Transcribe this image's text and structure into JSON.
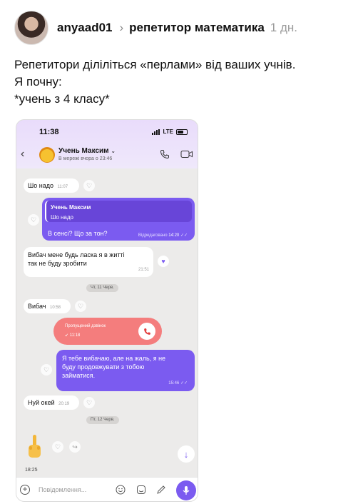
{
  "post": {
    "username": "anyaad01",
    "chevron": "›",
    "topic": "репетитор математика",
    "time": "1 дн.",
    "lines": [
      "Репетитори діліліться «перлами» від ваших учнів.",
      "Я почну:",
      "*учень з 4 класу*"
    ]
  },
  "phone": {
    "status_time": "11:38",
    "network": "LTE",
    "contact_name": "Учень Максим",
    "contact_dropdown": "⌄",
    "contact_status": "В мережі вчора о 23:46",
    "back_icon": "‹",
    "messages": [
      {
        "text": "Шо надо",
        "time": "11:07"
      },
      {
        "reply_name": "Учень Максим",
        "reply_text": "Шо надо",
        "text": "В сенсі? Що за тон?",
        "edited": "Відредаговано",
        "time": "14:20"
      },
      {
        "text_l1": "Вибач мене будь ласка я в житті",
        "text_l2": "так не буду зробити",
        "time": "21:51"
      },
      {
        "text": "Вибач",
        "time": "10:58"
      },
      {
        "text_l1": "Я тебе вибачаю, але на жаль, я не",
        "text_l2": "буду продовжувати з тобою",
        "text_l3": "займатися.",
        "time": "15:46"
      },
      {
        "text": "Нуй окей",
        "time": "20:19"
      }
    ],
    "date_chips": [
      "Чт, 11 Черв.",
      "Пт, 12 Черв."
    ],
    "missed_call": {
      "title": "Пропущений дзвінок",
      "time": "11:18"
    },
    "hand_time": "18:25",
    "composer_placeholder": "Повідомлення...",
    "colors": {
      "accent": "#7b5bf0",
      "missed": "#f47d7d"
    }
  }
}
